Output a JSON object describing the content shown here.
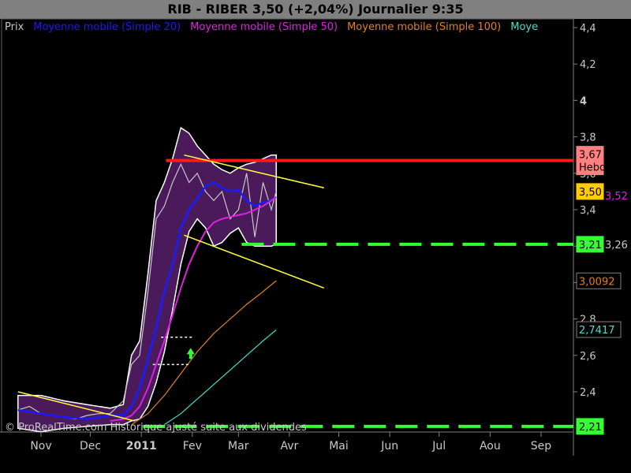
{
  "header": {
    "title": "RIB - RIBER     3,50 (+2,04%)     Journalier  9:35"
  },
  "legend": {
    "items": [
      {
        "label": "Prix",
        "color": "#c8c8c8"
      },
      {
        "label": "Moyenne mobile (Simple 20)",
        "color": "#1a1aff"
      },
      {
        "label": "Moyenne mobile (Simple 50)",
        "color": "#e020e0"
      },
      {
        "label": "Moyenne mobile (Simple 100)",
        "color": "#e08020"
      },
      {
        "label": "Moye",
        "color": "#40e0d0"
      }
    ]
  },
  "footer_note": "© ProRealTime.com Historique ajusté suite aux dividendes",
  "chart_data": {
    "type": "line",
    "ylim": [
      2.18,
      4.47
    ],
    "y_ticks": [
      "2,4",
      "2,6",
      "2,8",
      "3",
      "3,2",
      "3,4",
      "3,6",
      "3,8",
      "4",
      "4,2",
      "4,4"
    ],
    "y_tick_values": [
      2.4,
      2.6,
      2.8,
      3.0,
      3.2,
      3.4,
      3.6,
      3.8,
      4.0,
      4.2,
      4.4
    ],
    "x_ticks": [
      "Nov",
      "Dec",
      "2011",
      "Fev",
      "Mar",
      "Avr",
      "Mai",
      "Jun",
      "Jul",
      "Aou",
      "Sep"
    ],
    "x_tick_days": [
      0,
      30,
      61,
      92,
      120,
      151,
      181,
      212,
      242,
      273,
      304
    ],
    "date_origin": "2010-11-01",
    "price": {
      "days": [
        -14,
        -7,
        0,
        7,
        14,
        21,
        28,
        35,
        42,
        50,
        55,
        60,
        65,
        70,
        75,
        80,
        85,
        90,
        95,
        100,
        105,
        110,
        115,
        120,
        125,
        130,
        135,
        140,
        143
      ],
      "values": [
        2.3,
        2.32,
        2.28,
        2.27,
        2.26,
        2.25,
        2.27,
        2.28,
        2.28,
        2.35,
        2.55,
        2.6,
        2.95,
        3.35,
        3.42,
        3.55,
        3.65,
        3.55,
        3.6,
        3.5,
        3.45,
        3.5,
        3.35,
        3.4,
        3.6,
        3.25,
        3.55,
        3.4,
        3.5
      ],
      "color": "#c8c8c8"
    },
    "bollinger": {
      "days": [
        -14,
        0,
        14,
        28,
        42,
        50,
        55,
        60,
        65,
        70,
        75,
        80,
        85,
        90,
        95,
        100,
        105,
        110,
        115,
        120,
        125,
        130,
        135,
        140,
        143
      ],
      "upper": [
        2.38,
        2.38,
        2.35,
        2.33,
        2.31,
        2.33,
        2.6,
        2.68,
        3.05,
        3.45,
        3.55,
        3.68,
        3.85,
        3.82,
        3.75,
        3.7,
        3.65,
        3.62,
        3.6,
        3.63,
        3.65,
        3.66,
        3.68,
        3.7,
        3.7
      ],
      "lower": [
        2.2,
        2.18,
        2.2,
        2.21,
        2.22,
        2.22,
        2.24,
        2.25,
        2.32,
        2.45,
        2.62,
        2.85,
        3.1,
        3.28,
        3.35,
        3.3,
        3.2,
        3.22,
        3.27,
        3.3,
        3.22,
        3.2,
        3.2,
        3.2,
        3.21
      ],
      "fill": "#4a1a5a"
    },
    "series": [
      {
        "name": "Moyenne mobile (Simple 20)",
        "color": "#1a1aff",
        "days": [
          -14,
          0,
          14,
          28,
          42,
          50,
          55,
          60,
          65,
          70,
          75,
          80,
          85,
          90,
          95,
          100,
          105,
          110,
          115,
          120,
          125,
          130,
          135,
          140,
          143
        ],
        "values": [
          2.3,
          2.28,
          2.26,
          2.25,
          2.27,
          2.27,
          2.32,
          2.42,
          2.58,
          2.75,
          2.95,
          3.1,
          3.3,
          3.4,
          3.46,
          3.53,
          3.55,
          3.52,
          3.5,
          3.51,
          3.45,
          3.42,
          3.44,
          3.45,
          3.47
        ]
      },
      {
        "name": "Moyenne mobile (Simple 50)",
        "color": "#e020e0",
        "days": [
          42,
          50,
          55,
          60,
          65,
          70,
          75,
          80,
          85,
          90,
          95,
          100,
          105,
          110,
          115,
          120,
          125,
          130,
          135,
          140,
          143
        ],
        "values": [
          2.24,
          2.25,
          2.27,
          2.32,
          2.42,
          2.55,
          2.68,
          2.82,
          2.97,
          3.1,
          3.2,
          3.28,
          3.33,
          3.35,
          3.36,
          3.37,
          3.38,
          3.4,
          3.42,
          3.45,
          3.47
        ]
      },
      {
        "name": "Moyenne mobile (Simple 100)",
        "color": "#e08020",
        "days": [
          55,
          65,
          75,
          85,
          95,
          105,
          115,
          125,
          135,
          143
        ],
        "values": [
          2.22,
          2.28,
          2.38,
          2.5,
          2.62,
          2.72,
          2.8,
          2.88,
          2.95,
          3.01
        ]
      },
      {
        "name": "Moye",
        "color": "#40e0d0",
        "days": [
          75,
          85,
          95,
          105,
          115,
          125,
          135,
          143
        ],
        "values": [
          2.22,
          2.28,
          2.36,
          2.44,
          2.52,
          2.6,
          2.68,
          2.74
        ]
      }
    ],
    "annotations": {
      "red_line": {
        "y": 3.67,
        "x1": 76,
        "x2": 304,
        "color": "#ff1a1a"
      },
      "green_dashed_1": {
        "y": 3.21,
        "x1": 122,
        "x2": 304,
        "color": "#33ff33"
      },
      "green_dashed_2": {
        "y": 2.21,
        "x1": 62,
        "x2": 304,
        "color": "#33ff33"
      },
      "yellow_lines": [
        {
          "x1": -14,
          "y1": 2.4,
          "x2": 57,
          "y2": 2.24
        },
        {
          "x1": 87,
          "y1": 3.7,
          "x2": 172,
          "y2": 3.52
        },
        {
          "x1": 87,
          "y1": 3.26,
          "x2": 172,
          "y2": 2.97
        }
      ],
      "white_dotted": [
        {
          "x1": 73,
          "x2": 92,
          "y": 2.7
        },
        {
          "x1": 68,
          "x2": 90,
          "y": 2.55
        }
      ],
      "green_arrow": {
        "x": 91,
        "y": 2.58
      }
    },
    "price_boxes": [
      {
        "text": "3,67",
        "subtext": "Hebdo",
        "value": 3.67,
        "bg": "#ff8080",
        "fg": "#000000"
      },
      {
        "text": "3,50",
        "value": 3.5,
        "bg": "#ffcc00",
        "fg": "#000000"
      },
      {
        "text": "3,21",
        "value": 3.21,
        "bg": "#33ff33",
        "fg": "#000000"
      },
      {
        "text": "3,0092",
        "value": 3.0092,
        "bg": "#000000",
        "fg": "#e08020"
      },
      {
        "text": "2,7417",
        "value": 2.7417,
        "bg": "#000000",
        "fg": "#40e0d0"
      },
      {
        "text": "2,21",
        "value": 2.21,
        "bg": "#33ff33",
        "fg": "#000000"
      }
    ],
    "hidden_labels": [
      "3,52",
      "3,26"
    ],
    "grid": false,
    "legend_position": "top-left"
  }
}
